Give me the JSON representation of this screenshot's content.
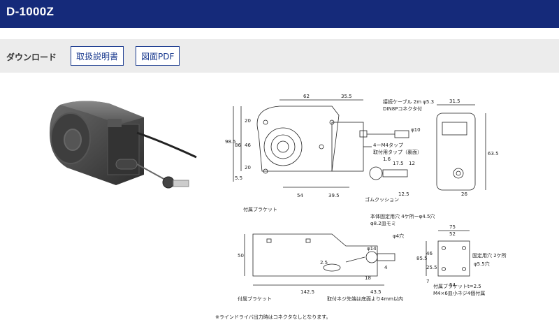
{
  "header": {
    "title": "D-1000Z"
  },
  "download": {
    "label": "ダウンロード",
    "manual_button": "取扱説明書",
    "drawing_button": "図面PDF"
  },
  "drawing": {
    "dims": {
      "d62": "62",
      "d35_5": "35.5",
      "d31_5": "31.5",
      "d98_5": "98.5",
      "d86": "86",
      "d46": "46",
      "d20a": "20",
      "d20b": "20",
      "d5_5": "5.5",
      "d54": "54",
      "d39_5": "39.5",
      "d12_5": "12.5",
      "d63_5": "63.5",
      "d26": "26",
      "d17_5": "17.5",
      "d1_6": "1.6",
      "d12": "12",
      "d10": "φ10",
      "d5_3": "φ5.3",
      "d14": "φ14",
      "d4": "φ4穴",
      "d50": "50",
      "d142_5": "142.5",
      "d43_5": "43.5",
      "d18": "18",
      "d4b": "4",
      "d2_5": "2.5",
      "d75": "75",
      "d52": "52",
      "d85_5": "85.5",
      "d46b": "46",
      "d25_5": "25.5",
      "d7": "7",
      "d54b": "54",
      "d5_5h": "φ5.5穴"
    },
    "labels": {
      "cable": "接続ケーブル 2m φ5.3",
      "din": "DIN8Pコネクタ付",
      "tap1": "4ーM4タップ",
      "tap2": "取付用タップ（裏面）",
      "bracket1": "付属ブラケット",
      "cushion": "ゴムクッション",
      "body_holes": "本体固定用穴 4ケ所ーφ4.5穴",
      "spot_face": "φ8.2皿モミ",
      "fix_holes": "固定用穴 2ケ所",
      "bracket2": "付属ブラケット",
      "screw_note": "取付ネジ先端は底面より4mm以内",
      "bracket_spec1": "付属ブラケットt=2.5",
      "bracket_spec2": "M4×6皿小ネジ4個付属"
    },
    "note": "※ラインドライバ出力時はコネクタなしとなります。"
  }
}
